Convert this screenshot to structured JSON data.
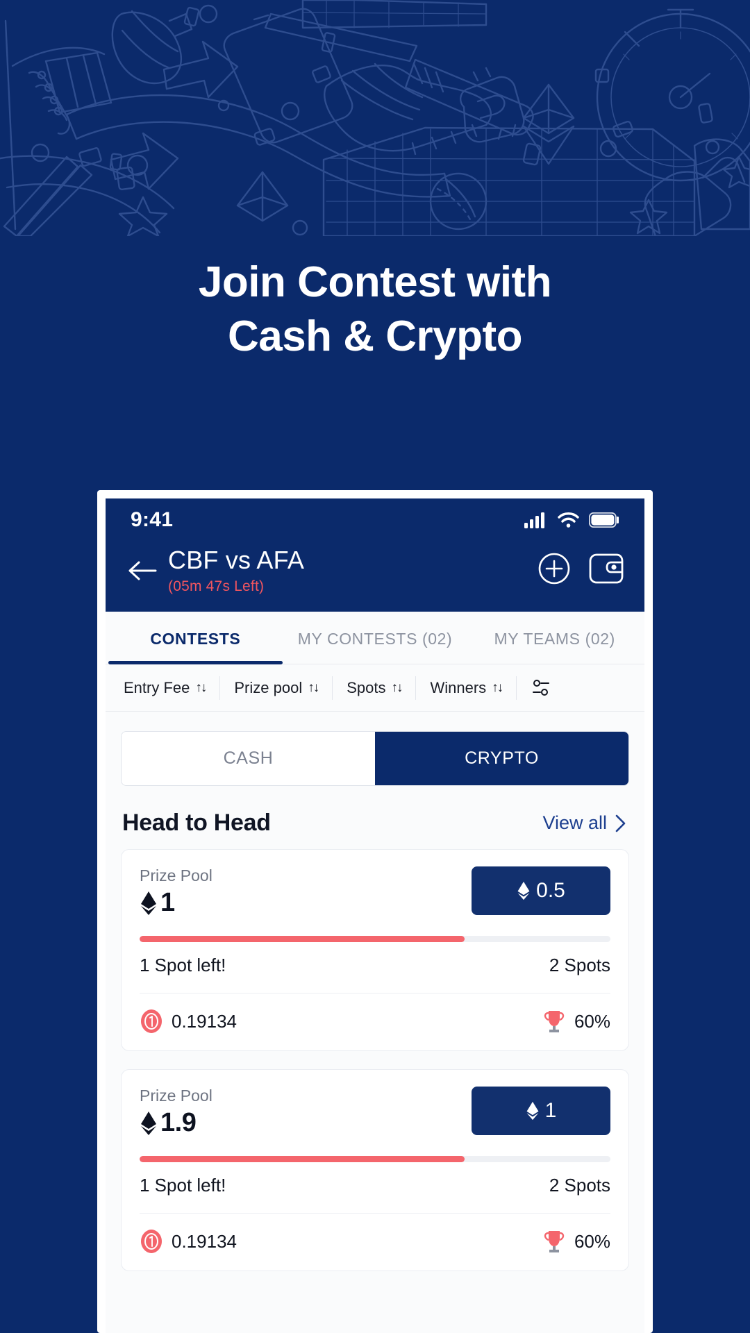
{
  "hero": {
    "headline_line1": "Join Contest with",
    "headline_line2": "Cash & Crypto",
    "background_color": "#0b2a6b",
    "pattern_color": "#2e4d8f"
  },
  "phone": {
    "status_bar": {
      "time": "9:41",
      "signal_icon": "cellular-signal-icon",
      "wifi_icon": "wifi-icon",
      "battery_icon": "battery-icon"
    },
    "app_bar": {
      "back_icon": "back-arrow-icon",
      "match_title": "CBF vs AFA",
      "timer": "(05m 47s Left)",
      "timer_color": "#f0555f",
      "add_icon": "plus-circle-icon",
      "wallet_icon": "wallet-icon"
    },
    "tabs": [
      {
        "label": "CONTESTS",
        "active": true
      },
      {
        "label": "MY CONTESTS (02)",
        "active": false
      },
      {
        "label": "MY TEAMS (02)",
        "active": false
      }
    ],
    "sort_bar": {
      "items": [
        {
          "label": "Entry Fee",
          "arrows": "↑↓"
        },
        {
          "label": "Prize pool",
          "arrows": "↑↓"
        },
        {
          "label": "Spots",
          "arrows": "↑↓"
        },
        {
          "label": "Winners",
          "arrows": "↑↓"
        }
      ],
      "filter_icon": "filter-sliders-icon"
    },
    "segment": {
      "cash_label": "CASH",
      "crypto_label": "CRYPTO",
      "active": "CRYPTO",
      "active_color": "#12306e"
    },
    "section": {
      "title": "Head to Head",
      "view_all_label": "View all",
      "chevron_icon": "chevron-right-icon"
    },
    "cards": [
      {
        "prize_pool_label": "Prize Pool",
        "prize_pool_value": "1",
        "prize_pool_currency_icon": "ethereum-icon",
        "join_value": "0.5",
        "join_currency_icon": "ethereum-icon",
        "progress_percent": 69,
        "spots_left": "1 Spot left!",
        "total_spots": "2 Spots",
        "entry_fee": "0.19134",
        "entry_fee_icon": "coin-one-icon",
        "winners_percent": "60%",
        "winners_icon": "trophy-icon"
      },
      {
        "prize_pool_label": "Prize Pool",
        "prize_pool_value": "1.9",
        "prize_pool_currency_icon": "ethereum-icon",
        "join_value": "1",
        "join_currency_icon": "ethereum-icon",
        "progress_percent": 69,
        "spots_left": "1 Spot left!",
        "total_spots": "2 Spots",
        "entry_fee": "0.19134",
        "entry_fee_icon": "coin-one-icon",
        "winners_percent": "60%",
        "winners_icon": "trophy-icon"
      }
    ]
  }
}
